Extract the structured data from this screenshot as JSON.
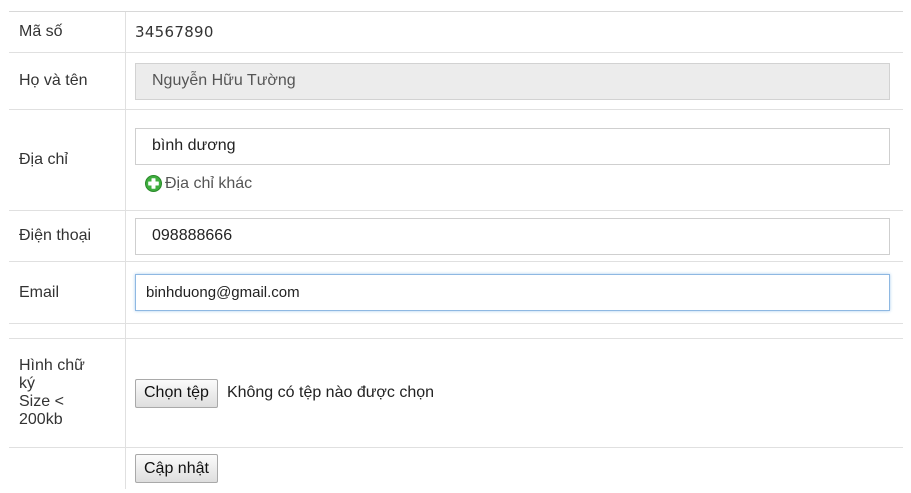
{
  "form": {
    "code": {
      "label": "Mã số",
      "value": "34567890"
    },
    "fullname": {
      "label": "Họ và tên",
      "value": "Nguyễn Hữu Tường"
    },
    "address": {
      "label": "Địa chỉ",
      "value": "bình  dương",
      "add_link": "Địa chỉ khác"
    },
    "phone": {
      "label": "Điện thoại",
      "value": "098888666"
    },
    "email": {
      "label": "Email",
      "value": "binhduong@gmail.com"
    },
    "signature": {
      "label_lines": [
        "Hình chữ",
        "ký",
        "Size <",
        "200kb"
      ],
      "choose_button": "Chọn tệp",
      "file_status": "Không có tệp nào được chọn"
    },
    "submit_button": "Cập nhật"
  }
}
